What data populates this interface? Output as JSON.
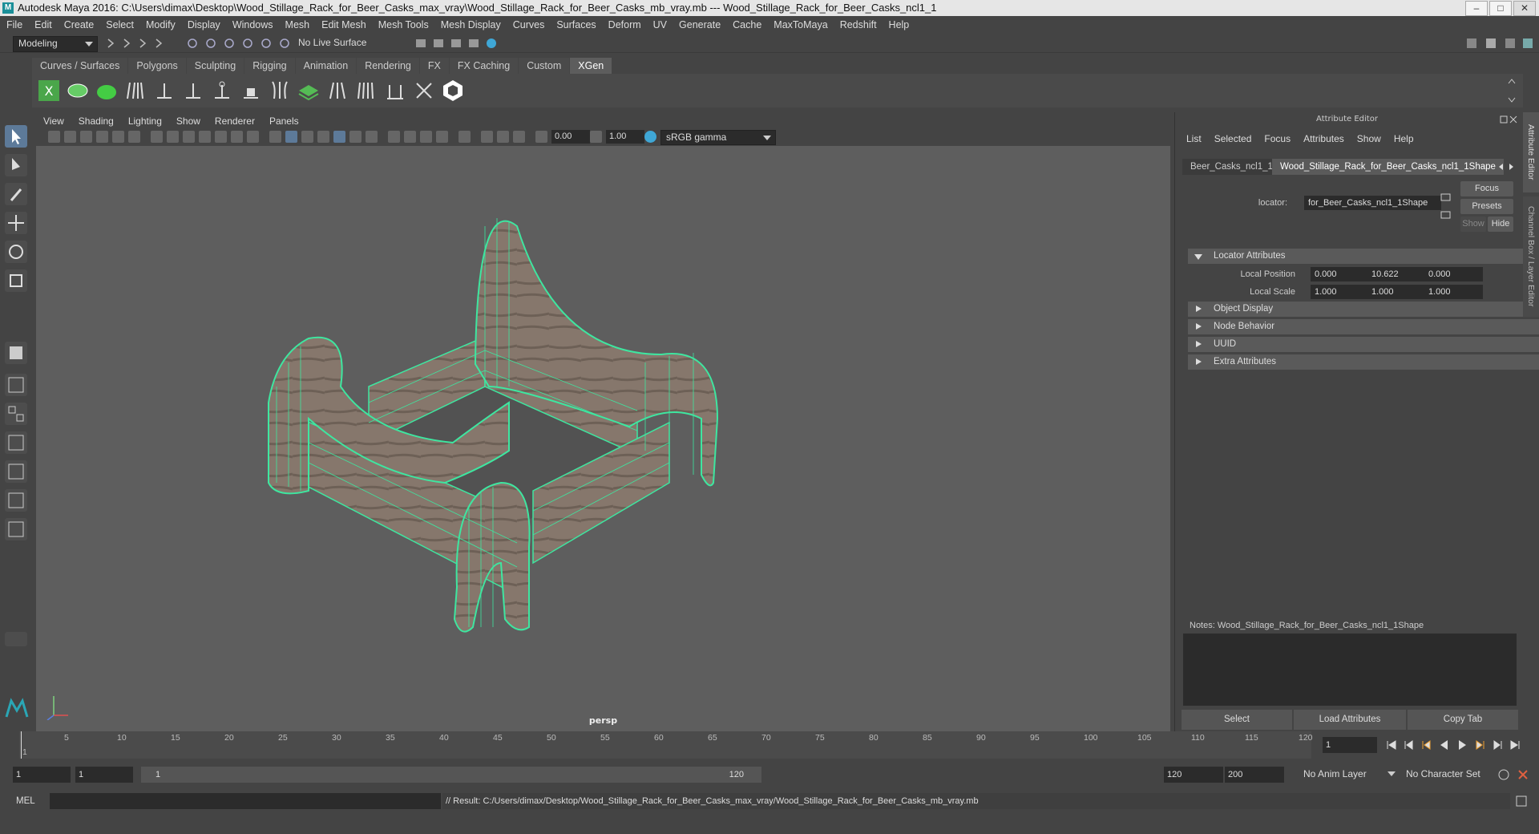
{
  "window": {
    "title": "Autodesk Maya 2016: C:\\Users\\dimax\\Desktop\\Wood_Stillage_Rack_for_Beer_Casks_max_vray\\Wood_Stillage_Rack_for_Beer_Casks_mb_vray.mb   ---   Wood_Stillage_Rack_for_Beer_Casks_ncl1_1",
    "minimize": "–",
    "maximize": "□",
    "close": "✕"
  },
  "menu": [
    "File",
    "Edit",
    "Create",
    "Select",
    "Modify",
    "Display",
    "Windows",
    "Mesh",
    "Edit Mesh",
    "Mesh Tools",
    "Mesh Display",
    "Curves",
    "Surfaces",
    "Deform",
    "UV",
    "Generate",
    "Cache",
    "MaxToMaya",
    "Redshift",
    "Help"
  ],
  "status": {
    "mode": "Modeling",
    "live_surface": "No Live Surface"
  },
  "shelf_tabs": [
    "Curves / Surfaces",
    "Polygons",
    "Sculpting",
    "Rigging",
    "Animation",
    "Rendering",
    "FX",
    "FX Caching",
    "Custom",
    "XGen"
  ],
  "active_shelf_tab": "XGen",
  "panel_menu": [
    "View",
    "Shading",
    "Lighting",
    "Show",
    "Renderer",
    "Panels"
  ],
  "panel_toolbar": {
    "exposure": "0.00",
    "gamma": "1.00",
    "color_space": "sRGB gamma"
  },
  "viewport": {
    "camera_label": "persp",
    "wire_color": "#3ee6a0"
  },
  "attribute_editor": {
    "title": "Attribute Editor",
    "menu": [
      "List",
      "Selected",
      "Focus",
      "Attributes",
      "Show",
      "Help"
    ],
    "tabs": [
      "Beer_Casks_ncl1_1",
      "Wood_Stillage_Rack_for_Beer_Casks_ncl1_1Shape"
    ],
    "locator_label": "locator:",
    "locator_value": "for_Beer_Casks_ncl1_1Shape",
    "buttons": {
      "focus": "Focus",
      "presets": "Presets",
      "show": "Show",
      "hide": "Hide"
    },
    "sections": {
      "locator_attributes": "Locator Attributes",
      "object_display": "Object Display",
      "node_behavior": "Node Behavior",
      "uuid": "UUID",
      "extra_attributes": "Extra Attributes"
    },
    "local_position": {
      "label": "Local Position",
      "x": "0.000",
      "y": "10.622",
      "z": "0.000"
    },
    "local_scale": {
      "label": "Local Scale",
      "x": "1.000",
      "y": "1.000",
      "z": "1.000"
    },
    "notes": "Notes:  Wood_Stillage_Rack_for_Beer_Casks_ncl1_1Shape",
    "bottom_buttons": {
      "select": "Select",
      "load": "Load Attributes",
      "copy": "Copy Tab"
    },
    "side_tabs": [
      "Attribute Editor",
      "Channel Box / Layer Editor"
    ]
  },
  "timeline": {
    "ticks": [
      "1",
      "5",
      "10",
      "15",
      "20",
      "25",
      "30",
      "35",
      "40",
      "45",
      "50",
      "55",
      "60",
      "65",
      "70",
      "75",
      "80",
      "85",
      "90",
      "95",
      "100",
      "105",
      "110",
      "115",
      "120"
    ],
    "current_frame": "1"
  },
  "range": {
    "start": "1",
    "playback_start": "1",
    "slider_start": "1",
    "slider_end": "120",
    "playback_end": "120",
    "end": "200",
    "anim_layer": "No Anim Layer",
    "character_set": "No Character Set"
  },
  "command": {
    "lang": "MEL",
    "result": "// Result: C:/Users/dimax/Desktop/Wood_Stillage_Rack_for_Beer_Casks_max_vray/Wood_Stillage_Rack_for_Beer_Casks_mb_vray.mb"
  }
}
